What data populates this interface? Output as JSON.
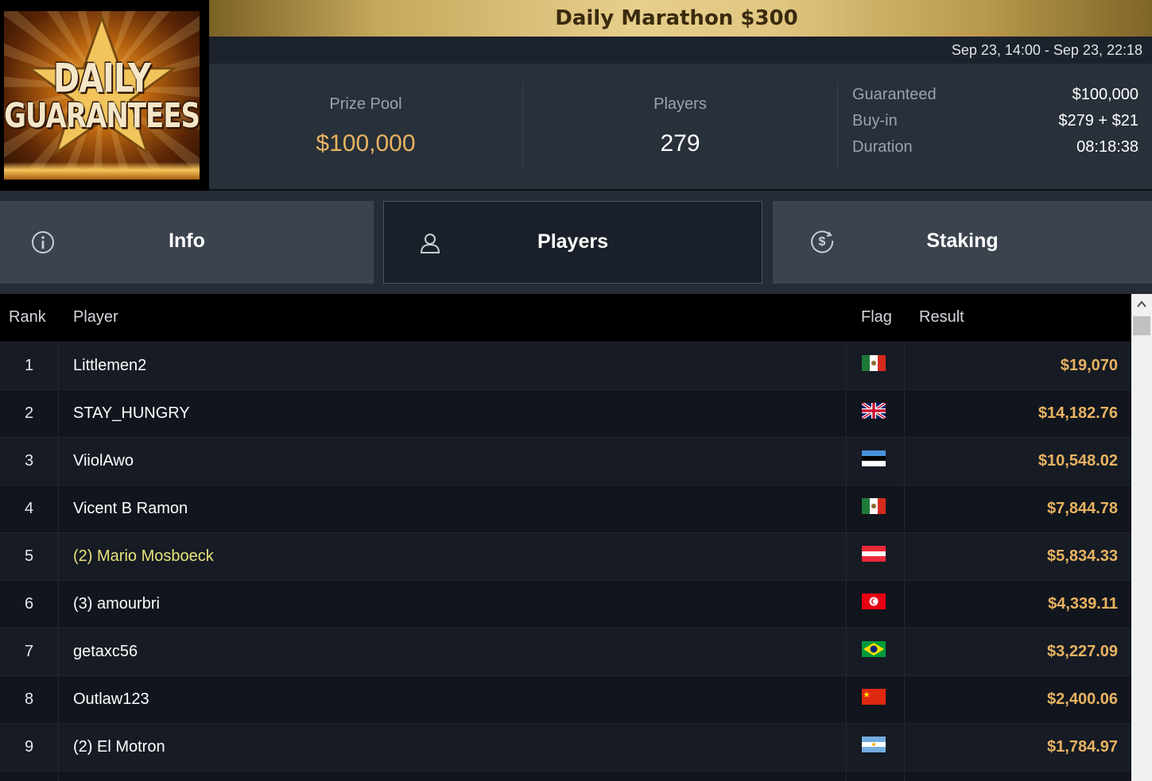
{
  "logo": {
    "line1": "DAILY",
    "line2": "GUARANTEES"
  },
  "header": {
    "title": "Daily Marathon $300",
    "dates": "Sep 23, 14:00 - Sep 23, 22:18"
  },
  "stats": {
    "prize_pool_label": "Prize Pool",
    "prize_pool_value": "$100,000",
    "players_label": "Players",
    "players_value": "279",
    "details": [
      {
        "label": "Guaranteed",
        "value": "$100,000"
      },
      {
        "label": "Buy-in",
        "value": "$279 + $21"
      },
      {
        "label": "Duration",
        "value": "08:18:38"
      }
    ]
  },
  "tabs": [
    {
      "label": "Info",
      "icon": "info-icon",
      "active": false
    },
    {
      "label": "Players",
      "icon": "user-icon",
      "active": true
    },
    {
      "label": "Staking",
      "icon": "dollar-coin-icon",
      "active": false
    }
  ],
  "table": {
    "headers": {
      "rank": "Rank",
      "player": "Player",
      "flag": "Flag",
      "result": "Result"
    },
    "rows": [
      {
        "rank": "1",
        "player": "Littlemen2",
        "flag": "mexico",
        "result": "$19,070"
      },
      {
        "rank": "2",
        "player": "STAY_HUNGRY",
        "flag": "united-kingdom",
        "result": "$14,182.76"
      },
      {
        "rank": "3",
        "player": "ViiolAwo",
        "flag": "estonia",
        "result": "$10,548.02"
      },
      {
        "rank": "4",
        "player": "Vicent B Ramon",
        "flag": "mexico",
        "result": "$7,844.78"
      },
      {
        "rank": "5",
        "player": "(2) Mario Mosboeck",
        "flag": "austria",
        "result": "$5,834.33"
      },
      {
        "rank": "6",
        "player": "(3) amourbri",
        "flag": "tunisia",
        "result": "$4,339.11"
      },
      {
        "rank": "7",
        "player": "getaxc56",
        "flag": "brazil",
        "result": "$3,227.09"
      },
      {
        "rank": "8",
        "player": "Outlaw123",
        "flag": "china",
        "result": "$2,400.06"
      },
      {
        "rank": "9",
        "player": "(2) El Motron",
        "flag": "argentina",
        "result": "$1,784.97"
      }
    ]
  }
}
